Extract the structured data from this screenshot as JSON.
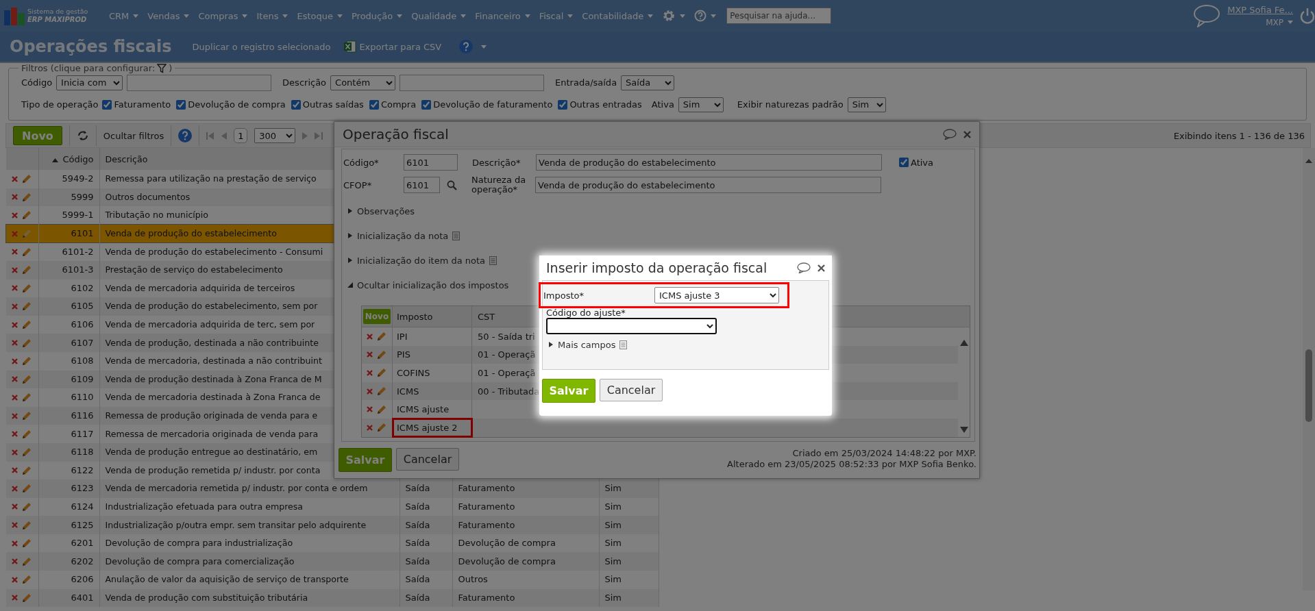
{
  "nav": {
    "logo_top": "Sistema de gestão",
    "logo_bottom": "ERP MAXIPROD",
    "menus": [
      "CRM",
      "Vendas",
      "Compras",
      "Itens",
      "Estoque",
      "Produção",
      "Qualidade",
      "Financeiro",
      "Fiscal",
      "Contabilidade"
    ],
    "search_placeholder": "Pesquisar na ajuda...",
    "user": "MXP Sofia Fe...",
    "company": "MXP"
  },
  "title_bar": {
    "title": "Operações fiscais",
    "duplicate": "Duplicar o registro selecionado",
    "export": "Exportar para CSV"
  },
  "filters": {
    "legend": "Filtros (clique para configurar:",
    "legend_end": ")",
    "code": {
      "label": "Código",
      "mode": "Inicia com"
    },
    "description": {
      "label": "Descrição",
      "mode": "Contém"
    },
    "direction": {
      "label": "Entrada/saída",
      "value": "Saída"
    },
    "operation_type": {
      "label": "Tipo de operação",
      "options": [
        {
          "label": "Faturamento",
          "checked": true
        },
        {
          "label": "Devolução de compra",
          "checked": true
        },
        {
          "label": "Outras saídas",
          "checked": true
        },
        {
          "label": "Compra",
          "checked": true
        },
        {
          "label": "Devolução de faturamento",
          "checked": true
        },
        {
          "label": "Outras entradas",
          "checked": true
        }
      ]
    },
    "active": {
      "label": "Ativa",
      "value": "Sim"
    },
    "standard": {
      "label": "Exibir naturezas padrão",
      "value": "Sim"
    }
  },
  "toolbar": {
    "new": "Novo",
    "hide_filters": "Ocultar filtros",
    "page": "1",
    "page_size": "300",
    "status": "Exibindo itens 1 - 136 de 136"
  },
  "table": {
    "columns": [
      {
        "label": "Código",
        "sorted_ascending": true
      },
      {
        "label": "Descrição",
        "sorted_ascending": false
      }
    ],
    "rows": [
      {
        "code": "5949-2",
        "description": "Remessa para utilização na prestação de serviço",
        "selected": false
      },
      {
        "code": "5999",
        "description": "Outros documentos",
        "selected": false
      },
      {
        "code": "5999-1",
        "description": "Tributação no município",
        "selected": false
      },
      {
        "code": "6101",
        "description": "Venda de produção do estabelecimento",
        "selected": true
      },
      {
        "code": "6101-2",
        "description": "Venda de produção do estabelecimento - Consumi",
        "selected": false
      },
      {
        "code": "6101-3",
        "description": "Prestação de serviço do estabelecimento",
        "selected": false
      },
      {
        "code": "6102",
        "description": "Venda de mercadoria adquirida de terceiros",
        "selected": false
      },
      {
        "code": "6105",
        "description": "Venda de produção do estabelecimento, sem por",
        "selected": false
      },
      {
        "code": "6106",
        "description": "Venda de mercadoria adquirida de terc, sem por",
        "selected": false
      },
      {
        "code": "6107",
        "description": "Venda de produção, destinada a não contribuinte",
        "selected": false
      },
      {
        "code": "6108",
        "description": "Venda de mercadoria, destinada a não contribuint",
        "selected": false
      },
      {
        "code": "6109",
        "description": "Venda de produção destinada à Zona Franca de M",
        "selected": false
      },
      {
        "code": "6110",
        "description": "Venda de mercadoria destinada à Zona Franca de",
        "selected": false
      },
      {
        "code": "6116",
        "description": "Remessa de produção originada de venda para e",
        "selected": false
      },
      {
        "code": "6117",
        "description": "Remessa de mercadoria originada de venda para",
        "selected": false
      },
      {
        "code": "6118",
        "description": "Venda de produção entregue ao destinatário, em",
        "selected": false
      },
      {
        "code": "6122",
        "description": "Venda de produção remetida p/ industr. por conta",
        "selected": false
      },
      {
        "code": "6123",
        "description": "Venda de mercadoria remetida p/ industr. por conta e ordem",
        "direction": "Saída",
        "type": "Faturamento",
        "active": "Sim",
        "selected": false
      },
      {
        "code": "6124",
        "description": "Industrialização efetuada para outra empresa",
        "direction": "Saída",
        "type": "Faturamento",
        "active": "Sim",
        "selected": false
      },
      {
        "code": "6125",
        "description": "Industrialização p/outra empr. sem transitar pelo adquirente",
        "direction": "Saída",
        "type": "Faturamento",
        "active": "Sim",
        "selected": false
      },
      {
        "code": "6201",
        "description": "Devolução de compra para industrialização",
        "direction": "Saída",
        "type": "Devolução de compra",
        "active": "Sim",
        "selected": false
      },
      {
        "code": "6202",
        "description": "Devolução de compra para comercialização",
        "direction": "Saída",
        "type": "Devolução de compra",
        "active": "Sim",
        "selected": false
      },
      {
        "code": "6206",
        "description": "Anulação de valor da aquisição de serviço de transporte",
        "direction": "Saída",
        "type": "Outros",
        "active": "Sim",
        "selected": false
      },
      {
        "code": "6401",
        "description": "Venda de produção com substituição tributária",
        "direction": "Saída",
        "type": "Faturamento",
        "active": "Sim",
        "selected": false
      }
    ]
  },
  "operation_dialog": {
    "title": "Operação fiscal",
    "code": {
      "label": "Código*",
      "value": "6101"
    },
    "description": {
      "label": "Descrição*",
      "value": "Venda de produção do estabelecimento"
    },
    "active": {
      "label": "Ativa",
      "checked": true
    },
    "cfop": {
      "label": "CFOP*",
      "value": "6101"
    },
    "nature": {
      "label": "Natureza da operação*",
      "value": "Venda de produção do estabelecimento"
    },
    "sections": [
      {
        "label": "Observações",
        "expanded": false,
        "notes_icon": false
      },
      {
        "label": "Inicialização da nota",
        "expanded": false,
        "notes_icon": true
      },
      {
        "label": "Inicialização do item da nota",
        "expanded": false,
        "notes_icon": true
      },
      {
        "label": "Ocultar inicialização dos impostos",
        "expanded": true,
        "notes_icon": false
      }
    ],
    "taxes": {
      "new": "Novo",
      "columns": [
        "Imposto",
        "CST"
      ],
      "rows": [
        {
          "tax": "IPI",
          "cst": "50 - Saída tri",
          "highlighted": false
        },
        {
          "tax": "PIS",
          "cst": "01 - Operaçã",
          "highlighted": false
        },
        {
          "tax": "COFINS",
          "cst": "01 - Operaçã",
          "highlighted": false
        },
        {
          "tax": "ICMS",
          "cst": "00 - Tributada",
          "highlighted": false
        },
        {
          "tax": "ICMS ajuste",
          "highlighted": false
        },
        {
          "tax": "ICMS ajuste 2",
          "highlighted": true
        }
      ]
    },
    "save": "Salvar",
    "cancel": "Cancelar",
    "created": "Criado em 25/03/2024 14:48:22 por MXP.",
    "modified": "Alterado em 23/05/2025 08:52:33 por MXP Sofia Benko."
  },
  "tax_dialog": {
    "title": "Inserir imposto da operação fiscal",
    "tax": {
      "label": "Imposto*",
      "value": "ICMS ajuste 3",
      "highlighted": true
    },
    "adjust_code": {
      "label": "Código do ajuste*",
      "highlighted": false
    },
    "more": {
      "label": "Mais campos",
      "expanded": false
    },
    "save": "Salvar",
    "cancel": "Cancelar"
  }
}
